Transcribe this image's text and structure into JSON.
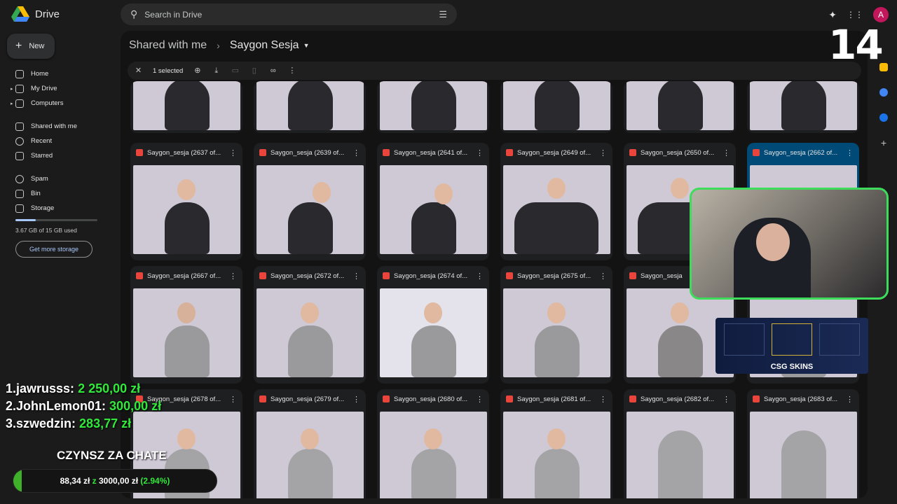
{
  "app": {
    "name": "Drive"
  },
  "search": {
    "placeholder": "Search in Drive"
  },
  "header": {
    "avatar_letter": "A"
  },
  "sidebar": {
    "new_label": "New",
    "items": [
      {
        "label": "Home",
        "caret": false
      },
      {
        "label": "My Drive",
        "caret": true
      },
      {
        "label": "Computers",
        "caret": true
      },
      {
        "label": "Shared with me",
        "caret": false
      },
      {
        "label": "Recent",
        "caret": false
      },
      {
        "label": "Starred",
        "caret": false
      },
      {
        "label": "Spam",
        "caret": false
      },
      {
        "label": "Bin",
        "caret": false
      },
      {
        "label": "Storage",
        "caret": false
      }
    ],
    "storage_text": "3.67 GB of 15 GB used",
    "storage_fraction": 0.245,
    "get_storage_label": "Get more storage"
  },
  "breadcrumb": {
    "parent": "Shared with me",
    "current": "Saygon Sesja"
  },
  "selection_bar": {
    "label": "1 selected"
  },
  "files": {
    "rows": [
      [
        "Saygon_sesja (2637 of...",
        "Saygon_sesja (2639 of...",
        "Saygon_sesja (2641 of...",
        "Saygon_sesja (2649 of...",
        "Saygon_sesja (2650 of...",
        "Saygon_sesja (2662 of..."
      ],
      [
        "Saygon_sesja (2667 of...",
        "Saygon_sesja (2672 of...",
        "Saygon_sesja (2674 of...",
        "Saygon_sesja (2675 of...",
        "Saygon_sesja",
        ""
      ],
      [
        "Saygon_sesja (2678 of...",
        "Saygon_sesja (2679 of...",
        "Saygon_sesja (2680 of...",
        "Saygon_sesja (2681 of...",
        "Saygon_sesja (2682 of...",
        "Saygon_sesja (2683 of..."
      ]
    ],
    "selected": "Saygon_sesja (2662 of..."
  },
  "stream": {
    "counter": "14",
    "leaderboard": [
      {
        "rank": "1.",
        "name": "jawrusss:",
        "amount": "2 250,00 zł"
      },
      {
        "rank": "2.",
        "name": "JohnLemon01:",
        "amount": "300,00 zł"
      },
      {
        "rank": "3.",
        "name": "szwedzin:",
        "amount": "283,77 zł"
      }
    ],
    "goal_title": "CZYNSZ ZA CHATE",
    "goal_current": "88,34 zł",
    "goal_of": "z",
    "goal_target": "3000,00 zł",
    "goal_percent": "(2.94%)",
    "goal_fraction": 0.0294,
    "sponsor": "CSG SKINS"
  },
  "colors": {
    "accent": "#a8c7fa",
    "selected_card": "#004a77",
    "goal_green": "#31e83b"
  }
}
